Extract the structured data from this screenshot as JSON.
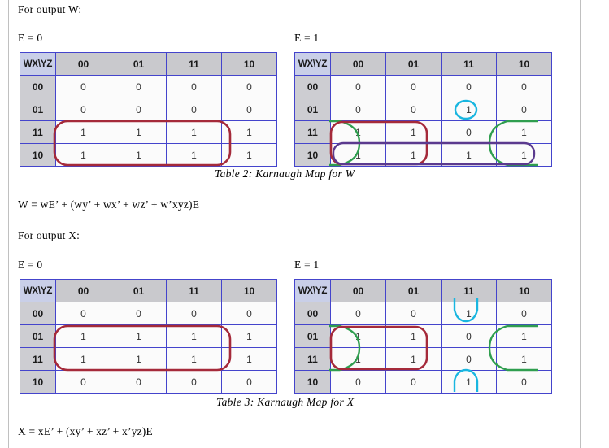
{
  "document": {
    "intro_w": "For output W:",
    "intro_x": "For output X:",
    "label_e0": "E = 0",
    "label_e1": "E = 1",
    "caption_w": "Table 2: Karnaugh Map for W",
    "caption_x": "Table 3: Karnaugh Map for X",
    "equation_w": "W = wE’ + (wy’ + wx’ + wz’ + w’xyz)E",
    "equation_x": "X = xE’ + (xy’ + xz’ + x’yz)E"
  },
  "colors": {
    "grid_border": "#4444cc",
    "header_fill": "#c9c9cd",
    "corner_fill": "#c9cfe8",
    "rowhead_fill": "#cdcdd2",
    "group_red": "#a52a3a",
    "group_green": "#2f9e4f",
    "group_cyan": "#19b6e0",
    "group_purple": "#5b3a8e",
    "page_rule": "#c0c0c0"
  },
  "kmaps": [
    {
      "id": "w-e0",
      "output": "W",
      "condition": "E = 0",
      "corner_label": "WX\\YZ",
      "col_headers": [
        "00",
        "01",
        "11",
        "10"
      ],
      "row_headers": [
        "00",
        "01",
        "11",
        "10"
      ],
      "cells": [
        [
          "0",
          "0",
          "0",
          "0"
        ],
        [
          "0",
          "0",
          "0",
          "0"
        ],
        [
          "1",
          "1",
          "1",
          "1"
        ],
        [
          "1",
          "1",
          "1",
          "1"
        ]
      ],
      "groups": [
        {
          "color": "#a52a3a",
          "shape": "rounded-rect",
          "covers": "rows 11-10, all columns"
        }
      ]
    },
    {
      "id": "w-e1",
      "output": "W",
      "condition": "E = 1",
      "corner_label": "WX\\YZ",
      "col_headers": [
        "00",
        "01",
        "11",
        "10"
      ],
      "row_headers": [
        "00",
        "01",
        "11",
        "10"
      ],
      "cells": [
        [
          "0",
          "0",
          "0",
          "0"
        ],
        [
          "0",
          "0",
          "1",
          "0"
        ],
        [
          "1",
          "1",
          "0",
          "1"
        ],
        [
          "1",
          "1",
          "1",
          "1"
        ]
      ],
      "groups": [
        {
          "color": "#19b6e0",
          "shape": "ellipse",
          "covers": "row 01, column 11"
        },
        {
          "color": "#a52a3a",
          "shape": "rounded-rect",
          "covers": "rows 11-10, columns 00-01"
        },
        {
          "color": "#2f9e4f",
          "shape": "wrap-horizontal",
          "covers": "rows 11-10, columns 00 and 10"
        },
        {
          "color": "#5b3a8e",
          "shape": "rounded-rect",
          "covers": "row 10, all columns"
        }
      ]
    },
    {
      "id": "x-e0",
      "output": "X",
      "condition": "E = 0",
      "corner_label": "WX\\YZ",
      "col_headers": [
        "00",
        "01",
        "11",
        "10"
      ],
      "row_headers": [
        "00",
        "01",
        "11",
        "10"
      ],
      "cells": [
        [
          "0",
          "0",
          "0",
          "0"
        ],
        [
          "1",
          "1",
          "1",
          "1"
        ],
        [
          "1",
          "1",
          "1",
          "1"
        ],
        [
          "0",
          "0",
          "0",
          "0"
        ]
      ],
      "groups": [
        {
          "color": "#a52a3a",
          "shape": "rounded-rect",
          "covers": "rows 01-11, all columns"
        }
      ]
    },
    {
      "id": "x-e1",
      "output": "X",
      "condition": "E = 1",
      "corner_label": "WX\\YZ",
      "col_headers": [
        "00",
        "01",
        "11",
        "10"
      ],
      "row_headers": [
        "00",
        "01",
        "11",
        "10"
      ],
      "cells": [
        [
          "0",
          "0",
          "1",
          "0"
        ],
        [
          "1",
          "1",
          "0",
          "1"
        ],
        [
          "1",
          "1",
          "0",
          "1"
        ],
        [
          "0",
          "0",
          "1",
          "0"
        ]
      ],
      "groups": [
        {
          "color": "#19b6e0",
          "shape": "wrap-vertical",
          "covers": "column 11, rows 00 and 10"
        },
        {
          "color": "#a52a3a",
          "shape": "rounded-rect",
          "covers": "rows 01-11, columns 00-01"
        },
        {
          "color": "#2f9e4f",
          "shape": "wrap-horizontal",
          "covers": "rows 01-11, columns 00 and 10"
        }
      ]
    }
  ]
}
